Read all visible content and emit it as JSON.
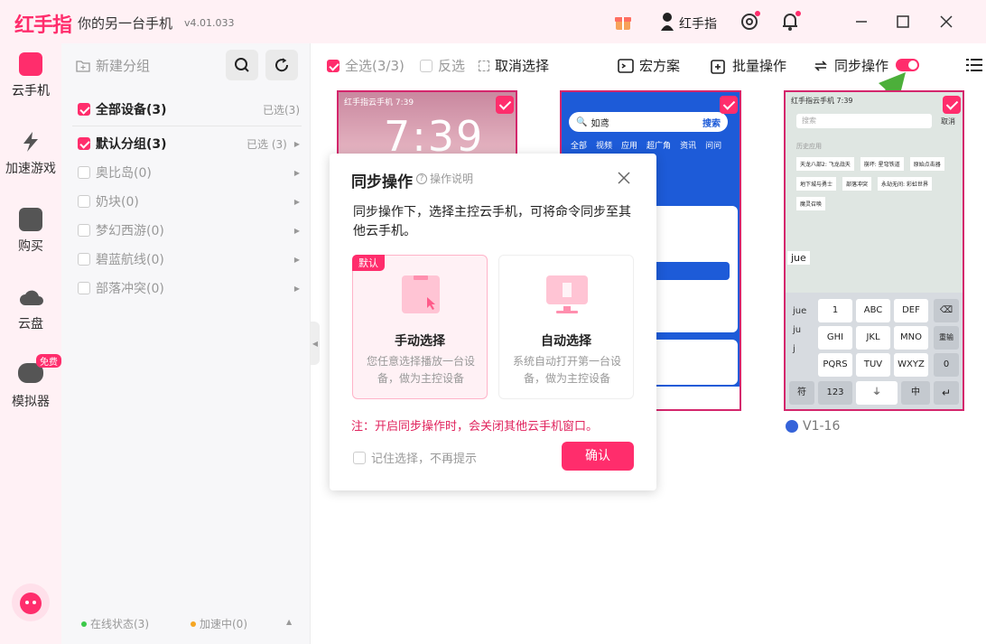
{
  "app": {
    "logo": "红手指",
    "slogan": "你的另一台手机",
    "version": "v4.01.033",
    "username": "红手指",
    "accent": "#ff2d6c"
  },
  "nav": [
    {
      "label": "云手机",
      "icon": "cloud-phone-icon"
    },
    {
      "label": "加速游戏",
      "icon": "lightning-icon"
    },
    {
      "label": "购买",
      "icon": "shopping-bag-icon"
    },
    {
      "label": "云盘",
      "icon": "cloud-drive-icon"
    },
    {
      "label": "模拟器",
      "icon": "gamepad-icon",
      "badge": "免费"
    }
  ],
  "groups": {
    "new_group": "新建分组",
    "rows": [
      {
        "label": "全部设备(3)",
        "selected": "已选(3)",
        "checked": true
      },
      {
        "label": "默认分组(3)",
        "selected": "已选 (3)",
        "checked": true
      },
      {
        "label": "奥比岛(0)",
        "selected": "",
        "checked": false
      },
      {
        "label": "奶块(0)",
        "selected": "",
        "checked": false
      },
      {
        "label": "梦幻西游(0)",
        "selected": "",
        "checked": false
      },
      {
        "label": "碧蓝航线(0)",
        "selected": "",
        "checked": false
      },
      {
        "label": "部落冲突(0)",
        "selected": "",
        "checked": false
      }
    ],
    "footer_online": "在线状态(3)",
    "footer_accel": "加速中(0)"
  },
  "toolbar": {
    "select_all": "全选(3/3)",
    "invert": "反选",
    "cancel": "取消选择",
    "macro": "宏方案",
    "batch": "批量操作",
    "sync": "同步操作"
  },
  "phones": {
    "p1_status": "红手指云手机 7:39",
    "p1_time": "7:39",
    "p2_search": "如鸢",
    "p2_search_btn": "搜索",
    "p2_tabs": [
      "全部",
      "视频",
      "应用",
      "超广角",
      "资讯",
      "问问"
    ],
    "p3_status": "红手指云手机 7:39",
    "p3_search": "搜索",
    "p3_cancel": "取消",
    "p3_history": "历史应用",
    "p3_chips": [
      "天龙八部2: 飞龙战天",
      "崩坏: 星穹铁道",
      "原始点击器",
      "地下城与勇士",
      "部落冲突",
      "永劫无间: 彩虹世界",
      "魔灵召唤"
    ],
    "p3_input": "jue",
    "p3_keys": [
      "1",
      "ABC",
      "DEF",
      "GHI",
      "JKL",
      "MNO",
      "PQRS",
      "TUV",
      "WXYZ",
      "符",
      "123",
      "中",
      "0",
      "重输"
    ],
    "p3_cands": [
      "jue",
      "ju",
      "j"
    ],
    "p3_name": "V1-16"
  },
  "dialog": {
    "title": "同步操作",
    "help": "操作说明",
    "desc": "同步操作下，选择主控云手机，可将命令同步至其他云手机。",
    "default_tag": "默认",
    "opt1_title": "手动选择",
    "opt1_desc": "您任意选择播放一台设备，做为主控设备",
    "opt2_title": "自动选择",
    "opt2_desc": "系统自动打开第一台设备，做为主控设备",
    "note": "注：开启同步操作时，会关闭其他云手机窗口。",
    "remember": "记住选择，不再提示",
    "confirm": "确认"
  }
}
